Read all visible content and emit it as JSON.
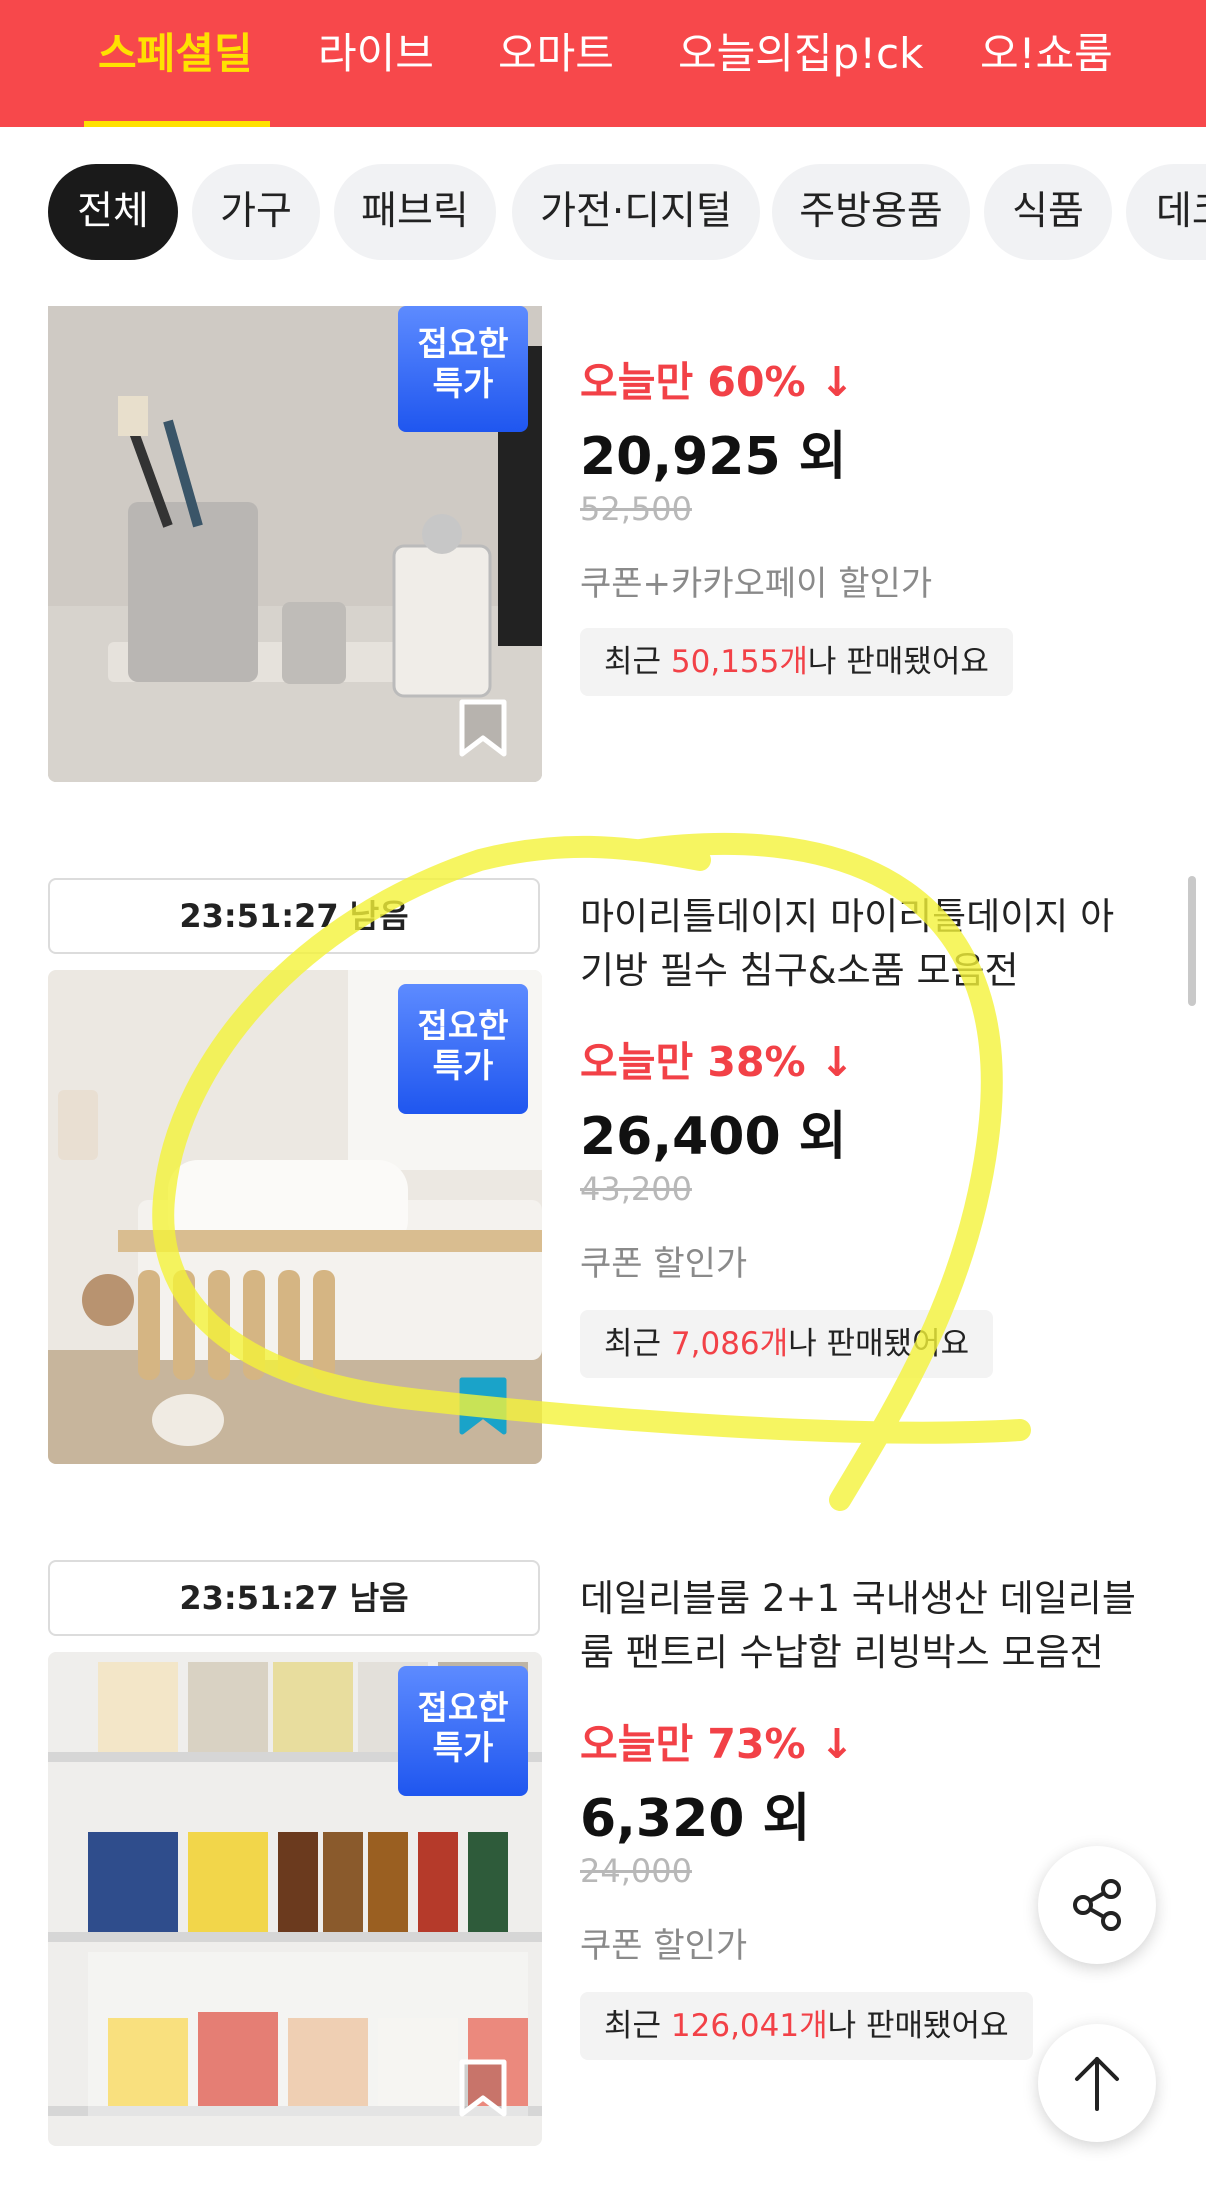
{
  "top_tabs": [
    "스페셜딜",
    "라이브",
    "오마트",
    "오늘의집p!ck",
    "오!쇼룸"
  ],
  "categories": [
    "전체",
    "가구",
    "패브릭",
    "가전·디지털",
    "주방용품",
    "식품",
    "데코"
  ],
  "badge_line1": "접요한",
  "badge_line2": "특가",
  "products": [
    {
      "title_line1": "",
      "title_line2": "",
      "timer": "",
      "discount_label": "오늘만 60%",
      "price": "20,925 외",
      "old_price": "52,500",
      "price_note": "쿠폰+카카오페이 할인가",
      "sold_prefix": "최근 ",
      "sold_count": "50,155개",
      "sold_suffix": "나 판매됐어요",
      "bookmarked": false
    },
    {
      "timer": "23:51:27 남음",
      "title_line1": "마이리틀데이지 마이리틀데이지 아",
      "title_line2": "기방 필수 침구&소품 모음전",
      "discount_label": "오늘만 38%",
      "price": "26,400 외",
      "old_price": "43,200",
      "price_note": "쿠폰 할인가",
      "sold_prefix": "최근 ",
      "sold_count": "7,086개",
      "sold_suffix": "나 판매됐어요",
      "bookmarked": true
    },
    {
      "timer": "23:51:27 남음",
      "title_line1": "데일리블룸 2+1 국내생산 데일리블",
      "title_line2": "룸 팬트리 수납함 리빙박스 모음전",
      "discount_label": "오늘만 73%",
      "price": "6,320 외",
      "old_price": "24,000",
      "price_note": "쿠폰 할인가",
      "sold_prefix": "최근 ",
      "sold_count": "126,041개",
      "sold_suffix": "나 판매됐어요",
      "bookmarked": false
    }
  ],
  "icons": {
    "down_arrow": "down-arrow-icon",
    "bookmark": "bookmark-icon",
    "share": "share-icon",
    "scroll_top": "arrow-up-icon"
  },
  "colors": {
    "brand_red": "#f7484b",
    "active_tab": "#ffe100",
    "discount": "#f24147",
    "badge_blue": "#2f63f3",
    "bookmark_active": "#1aa3c9",
    "annotation_yellow": "#f4f23a"
  },
  "product_images": [
    "images/bathroom-toothbrush-holder-set.jpg",
    "images/kids-bedroom-daybed.jpg",
    "images/pantry-storage-boxes.jpg"
  ]
}
